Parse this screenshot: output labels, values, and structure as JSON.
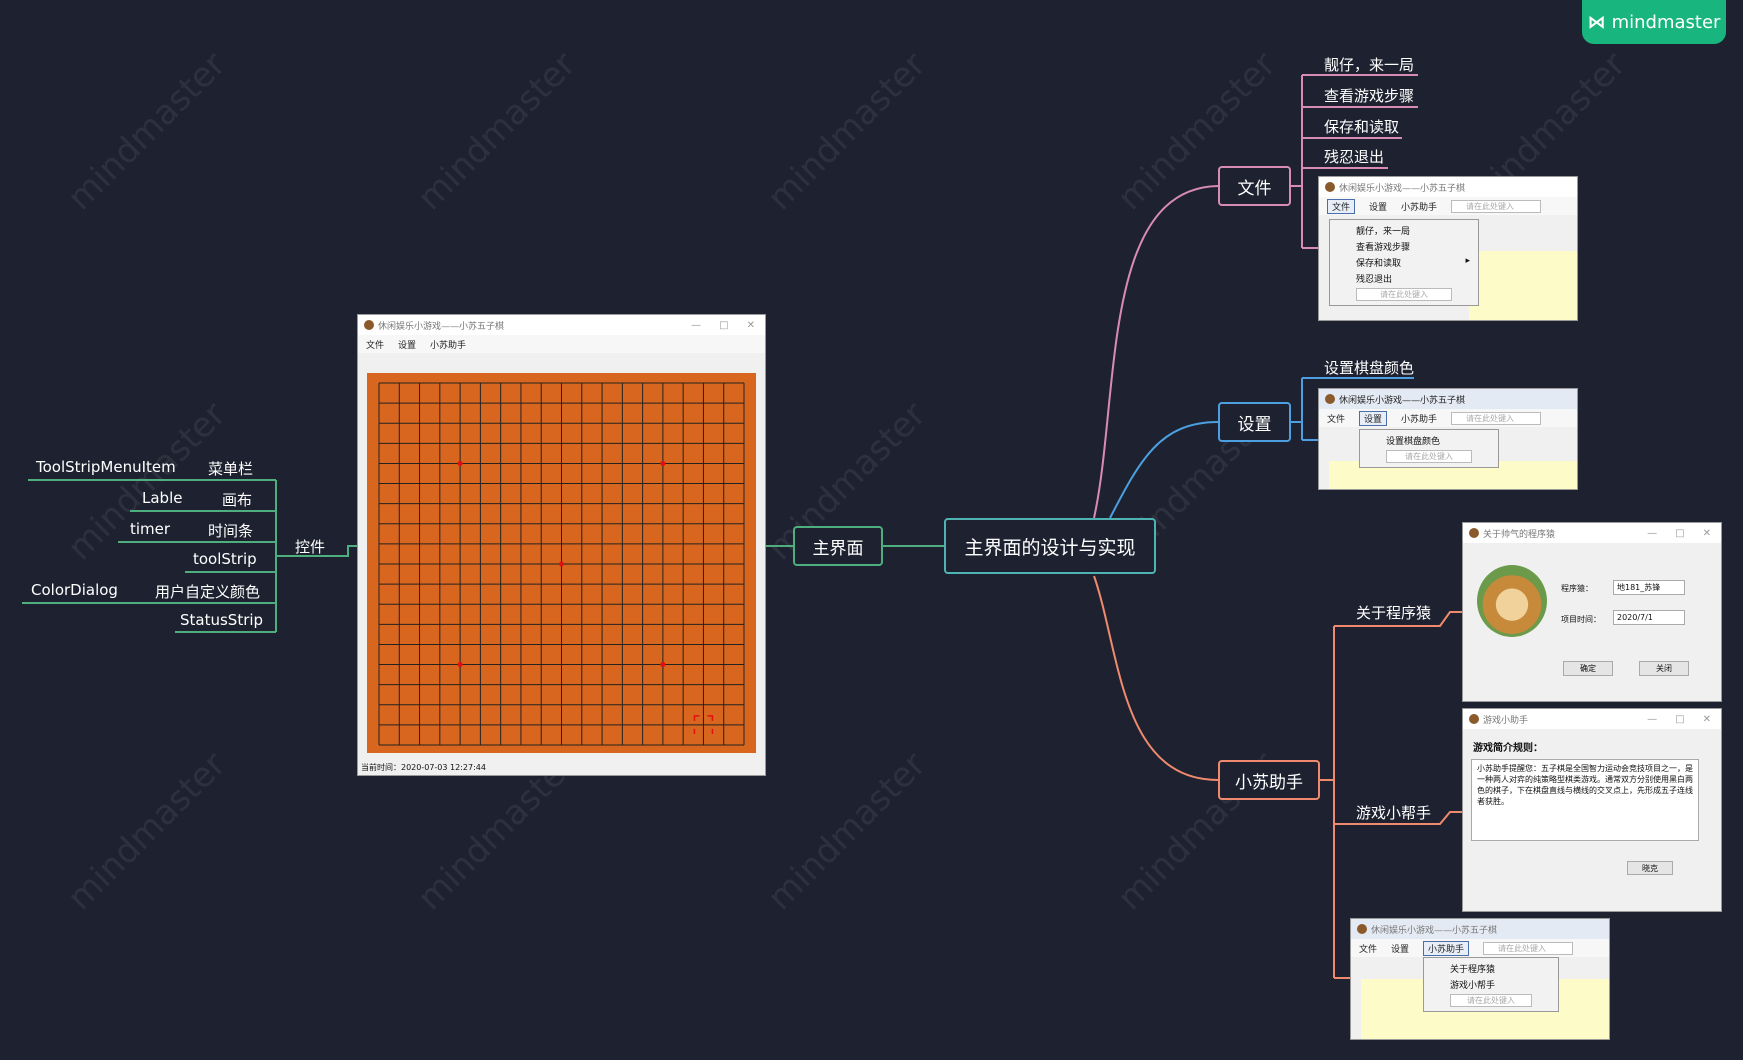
{
  "brand": {
    "name": "mindmaster",
    "watermark": "mindmaster"
  },
  "central": {
    "label": "主界面的设计与实现"
  },
  "main_ui": {
    "label": "主界面"
  },
  "controls": {
    "label": "控件",
    "items": [
      {
        "left": "ToolStripMenuItem",
        "right": "菜单栏"
      },
      {
        "left": "Lable",
        "right": "画布"
      },
      {
        "left": "timer",
        "right": "时间条"
      },
      {
        "left": "",
        "right": "toolStrip"
      },
      {
        "left": "ColorDialog",
        "right": "用户自定义颜色"
      },
      {
        "left": "",
        "right": "StatusStrip"
      }
    ]
  },
  "file_branch": {
    "label": "文件",
    "items": [
      "靓仔，来一局",
      "查看游戏步骤",
      "保存和读取",
      "残忍退出"
    ]
  },
  "settings_branch": {
    "label": "设置",
    "items": [
      "设置棋盘颜色"
    ]
  },
  "helper_branch": {
    "label": "小苏助手",
    "items": [
      "关于程序猿",
      "游戏小帮手"
    ]
  },
  "game_window": {
    "title": "休闲娱乐小游戏——小苏五子棋",
    "menu": [
      "文件",
      "设置",
      "小苏助手"
    ],
    "input_placeholder": "请在此处键入",
    "status": "当前时间：2020-07-03 12:27:44",
    "board_color": "#d8661f",
    "grid_lines": 19
  },
  "about_window": {
    "title": "关于帅气的程序猿",
    "programmer_label": "程序猿：",
    "programmer_value": "地181_苏锋",
    "time_label": "项目时间：",
    "time_value": "2020/7/1",
    "ok_button": "确定",
    "close_button": "关闭"
  },
  "help_window": {
    "title": "游戏小助手",
    "heading": "游戏简介规则：",
    "body": "小苏助手提醒您：五子棋是全国智力运动会竞技项目之一，是一种两人对弈的纯策略型棋类游戏。通常双方分别使用黑白两色的棋子，下在棋盘直线与横线的交叉点上，先形成五子连线者获胜。",
    "ok_button": "晓克"
  },
  "colors": {
    "background": "#1e2230",
    "central_border": "#4fb3b3",
    "green": "#4fae7e",
    "pink": "#d98cb3",
    "blue": "#4c9fe0",
    "orange": "#f08a6e",
    "badge": "#18b67e"
  }
}
